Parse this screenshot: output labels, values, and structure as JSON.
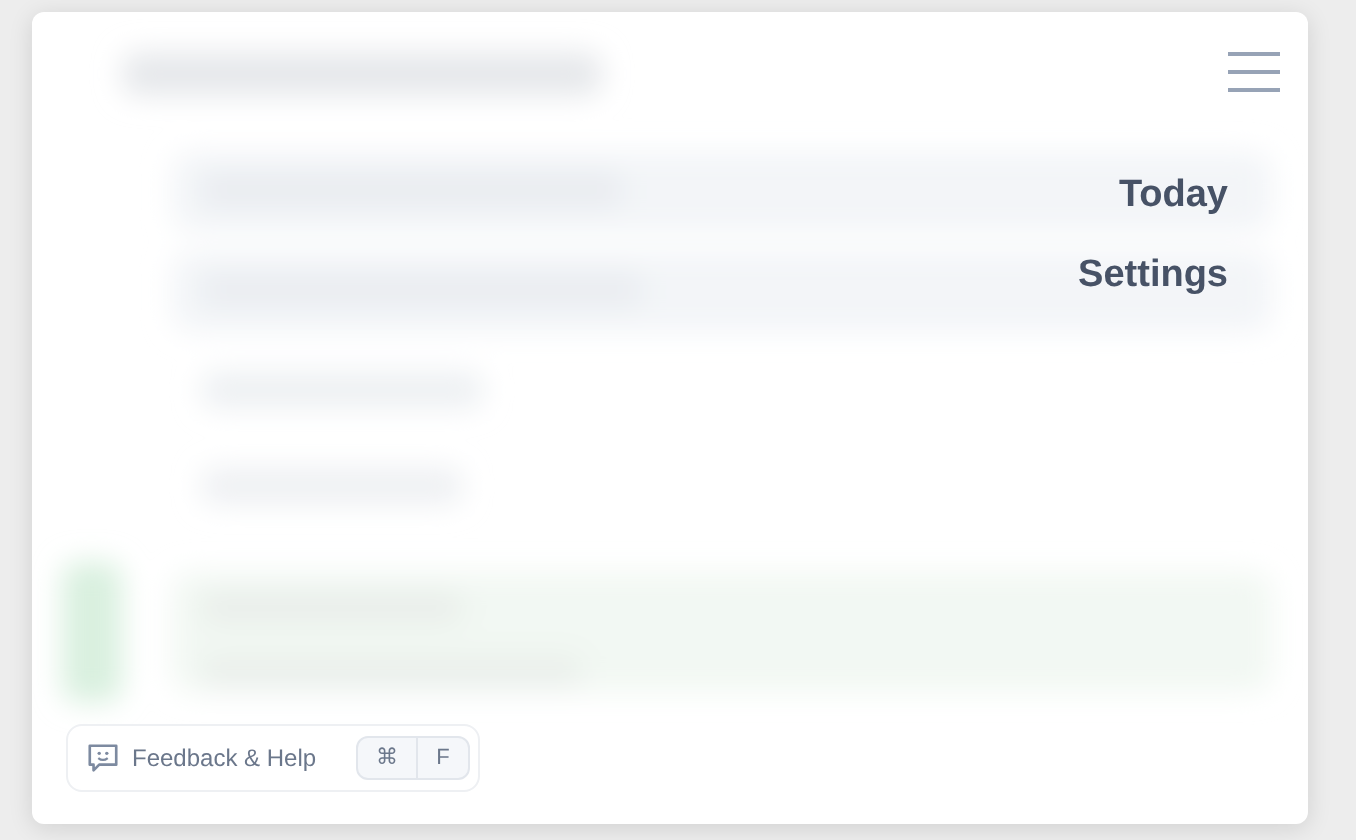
{
  "menu": {
    "items": [
      {
        "label": "Today"
      },
      {
        "label": "Settings"
      }
    ]
  },
  "feedback": {
    "label": "Feedback & Help",
    "keys": [
      "⌘",
      "F"
    ]
  }
}
